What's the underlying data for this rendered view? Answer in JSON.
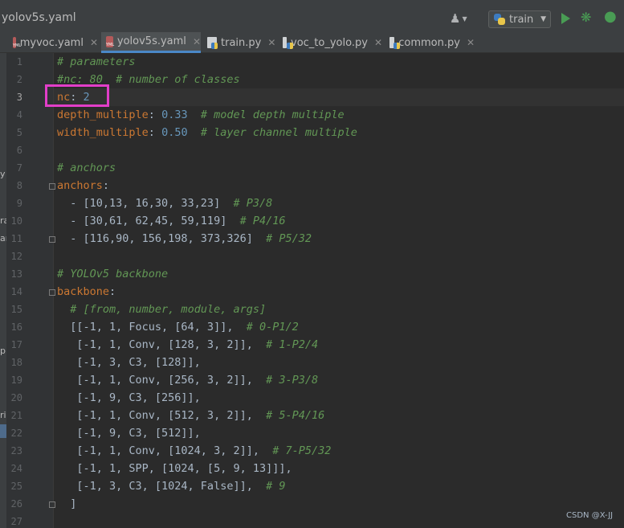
{
  "window": {
    "file_title": "yolov5s.yaml",
    "user_icon": "user-icon",
    "run_config": "train",
    "run_config_icon": "python-icon",
    "run_icon": "play-icon",
    "debug_icon": "bug-icon"
  },
  "tabs": [
    {
      "label": "myvoc.yaml",
      "icon": "yaml-file-icon",
      "active": false
    },
    {
      "label": "yolov5s.yaml",
      "icon": "yaml-file-icon",
      "active": true
    },
    {
      "label": "train.py",
      "icon": "python-file-icon",
      "active": false
    },
    {
      "label": "voc_to_yolo.py",
      "icon": "python-file-icon",
      "active": false
    },
    {
      "label": "common.py",
      "icon": "python-file-icon",
      "active": false
    }
  ],
  "editor": {
    "current_line": 3,
    "line_numbers": [
      "1",
      "2",
      "3",
      "4",
      "5",
      "6",
      "7",
      "8",
      "9",
      "10",
      "11",
      "12",
      "13",
      "14",
      "15",
      "16",
      "17",
      "18",
      "19",
      "20",
      "21",
      "22",
      "23",
      "24",
      "25",
      "26",
      "27"
    ],
    "lines": [
      [
        {
          "t": "# parameters",
          "c": "cm"
        }
      ],
      [
        {
          "t": "#nc: 80  # number of classes",
          "c": "cm"
        }
      ],
      [
        {
          "t": "nc",
          "c": "key"
        },
        {
          "t": ": ",
          "c": "txt"
        },
        {
          "t": "2",
          "c": "num"
        }
      ],
      [
        {
          "t": "depth_multiple",
          "c": "key"
        },
        {
          "t": ": ",
          "c": "txt"
        },
        {
          "t": "0.33",
          "c": "num"
        },
        {
          "t": "  ",
          "c": "txt"
        },
        {
          "t": "# model depth multiple",
          "c": "cm"
        }
      ],
      [
        {
          "t": "width_multiple",
          "c": "key"
        },
        {
          "t": ": ",
          "c": "txt"
        },
        {
          "t": "0.50",
          "c": "num"
        },
        {
          "t": "  ",
          "c": "txt"
        },
        {
          "t": "# layer channel multiple",
          "c": "cm"
        }
      ],
      [],
      [
        {
          "t": "# anchors",
          "c": "cm"
        }
      ],
      [
        {
          "t": "anchors",
          "c": "key"
        },
        {
          "t": ":",
          "c": "txt"
        }
      ],
      [
        {
          "t": "  - [10,13, 16,30, 33,23]  ",
          "c": "txt"
        },
        {
          "t": "# P3/8",
          "c": "cm"
        }
      ],
      [
        {
          "t": "  - [30,61, 62,45, 59,119]  ",
          "c": "txt"
        },
        {
          "t": "# P4/16",
          "c": "cm"
        }
      ],
      [
        {
          "t": "  - [116,90, 156,198, 373,326]  ",
          "c": "txt"
        },
        {
          "t": "# P5/32",
          "c": "cm"
        }
      ],
      [],
      [
        {
          "t": "# YOLOv5 backbone",
          "c": "cm"
        }
      ],
      [
        {
          "t": "backbone",
          "c": "key"
        },
        {
          "t": ":",
          "c": "txt"
        }
      ],
      [
        {
          "t": "  ",
          "c": "txt"
        },
        {
          "t": "# [from, number, module, args]",
          "c": "cm"
        }
      ],
      [
        {
          "t": "  [[-1, 1, Focus, [64, 3]],  ",
          "c": "txt"
        },
        {
          "t": "# 0-P1/2",
          "c": "cm"
        }
      ],
      [
        {
          "t": "   [-1, 1, Conv, [128, 3, 2]],  ",
          "c": "txt"
        },
        {
          "t": "# 1-P2/4",
          "c": "cm"
        }
      ],
      [
        {
          "t": "   [-1, 3, C3, [128]],",
          "c": "txt"
        }
      ],
      [
        {
          "t": "   [-1, 1, Conv, [256, 3, 2]],  ",
          "c": "txt"
        },
        {
          "t": "# 3-P3/8",
          "c": "cm"
        }
      ],
      [
        {
          "t": "   [-1, 9, C3, [256]],",
          "c": "txt"
        }
      ],
      [
        {
          "t": "   [-1, 1, Conv, [512, 3, 2]],  ",
          "c": "txt"
        },
        {
          "t": "# 5-P4/16",
          "c": "cm"
        }
      ],
      [
        {
          "t": "   [-1, 9, C3, [512]],",
          "c": "txt"
        }
      ],
      [
        {
          "t": "   [-1, 1, Conv, [1024, 3, 2]],  ",
          "c": "txt"
        },
        {
          "t": "# 7-P5/32",
          "c": "cm"
        }
      ],
      [
        {
          "t": "   [-1, 1, SPP, [1024, [5, 9, 13]]],",
          "c": "txt"
        }
      ],
      [
        {
          "t": "   [-1, 3, C3, [1024, False]],  ",
          "c": "txt"
        },
        {
          "t": "# 9",
          "c": "cm"
        }
      ],
      [
        {
          "t": "  ]",
          "c": "txt"
        }
      ],
      []
    ]
  },
  "left_edge_fragments": [
    "y",
    "ra",
    "ar",
    "p",
    "ri"
  ],
  "watermark": "CSDN @X-JJ",
  "colors": {
    "background": "#2b2b2b",
    "gutter": "#313335",
    "keyword": "#cc7832",
    "number": "#6897bb",
    "comment": "#629755",
    "text": "#a9b7c6",
    "highlight_box": "#e23ec8",
    "active_tab_underline": "#4a88c7",
    "run_green": "#499c54"
  }
}
